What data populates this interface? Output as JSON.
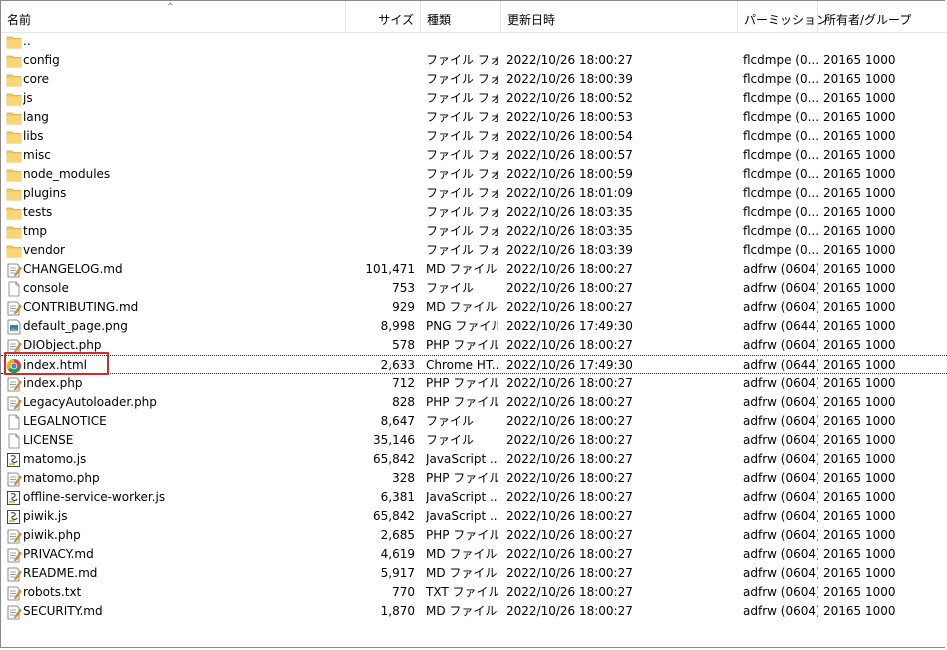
{
  "columns": {
    "name": "名前",
    "size": "サイズ",
    "type": "種類",
    "modified": "更新日時",
    "permission": "パーミッション",
    "owner": "所有者/グループ"
  },
  "rows": [
    {
      "name": "..",
      "size": "",
      "type": "",
      "date": "",
      "perm": "",
      "owner": "",
      "icon": "folder-icon"
    },
    {
      "name": "config",
      "size": "",
      "type": "ファイル フォ...",
      "date": "2022/10/26 18:00:27",
      "perm": "flcdmpe (0...",
      "owner": "20165 1000",
      "icon": "folder-icon"
    },
    {
      "name": "core",
      "size": "",
      "type": "ファイル フォ...",
      "date": "2022/10/26 18:00:39",
      "perm": "flcdmpe (0...",
      "owner": "20165 1000",
      "icon": "folder-icon"
    },
    {
      "name": "js",
      "size": "",
      "type": "ファイル フォ...",
      "date": "2022/10/26 18:00:52",
      "perm": "flcdmpe (0...",
      "owner": "20165 1000",
      "icon": "folder-icon"
    },
    {
      "name": "lang",
      "size": "",
      "type": "ファイル フォ...",
      "date": "2022/10/26 18:00:53",
      "perm": "flcdmpe (0...",
      "owner": "20165 1000",
      "icon": "folder-icon"
    },
    {
      "name": "libs",
      "size": "",
      "type": "ファイル フォ...",
      "date": "2022/10/26 18:00:54",
      "perm": "flcdmpe (0...",
      "owner": "20165 1000",
      "icon": "folder-icon"
    },
    {
      "name": "misc",
      "size": "",
      "type": "ファイル フォ...",
      "date": "2022/10/26 18:00:57",
      "perm": "flcdmpe (0...",
      "owner": "20165 1000",
      "icon": "folder-icon"
    },
    {
      "name": "node_modules",
      "size": "",
      "type": "ファイル フォ...",
      "date": "2022/10/26 18:00:59",
      "perm": "flcdmpe (0...",
      "owner": "20165 1000",
      "icon": "folder-icon"
    },
    {
      "name": "plugins",
      "size": "",
      "type": "ファイル フォ...",
      "date": "2022/10/26 18:01:09",
      "perm": "flcdmpe (0...",
      "owner": "20165 1000",
      "icon": "folder-icon"
    },
    {
      "name": "tests",
      "size": "",
      "type": "ファイル フォ...",
      "date": "2022/10/26 18:03:35",
      "perm": "flcdmpe (0...",
      "owner": "20165 1000",
      "icon": "folder-icon"
    },
    {
      "name": "tmp",
      "size": "",
      "type": "ファイル フォ...",
      "date": "2022/10/26 18:03:35",
      "perm": "flcdmpe (0...",
      "owner": "20165 1000",
      "icon": "folder-icon"
    },
    {
      "name": "vendor",
      "size": "",
      "type": "ファイル フォ...",
      "date": "2022/10/26 18:03:39",
      "perm": "flcdmpe (0...",
      "owner": "20165 1000",
      "icon": "folder-icon"
    },
    {
      "name": "CHANGELOG.md",
      "size": "101,471",
      "type": "MD ファイル",
      "date": "2022/10/26 18:00:27",
      "perm": "adfrw (0604)",
      "owner": "20165 1000",
      "icon": "markdown-file-icon"
    },
    {
      "name": "console",
      "size": "753",
      "type": "ファイル",
      "date": "2022/10/26 18:00:27",
      "perm": "adfrw (0604)",
      "owner": "20165 1000",
      "icon": "blank-file-icon"
    },
    {
      "name": "CONTRIBUTING.md",
      "size": "929",
      "type": "MD ファイル",
      "date": "2022/10/26 18:00:27",
      "perm": "adfrw (0604)",
      "owner": "20165 1000",
      "icon": "markdown-file-icon"
    },
    {
      "name": "default_page.png",
      "size": "8,998",
      "type": "PNG ファイル",
      "date": "2022/10/26 17:49:30",
      "perm": "adfrw (0644)",
      "owner": "20165 1000",
      "icon": "image-file-icon"
    },
    {
      "name": "DIObject.php",
      "size": "578",
      "type": "PHP ファイル",
      "date": "2022/10/26 18:00:27",
      "perm": "adfrw (0604)",
      "owner": "20165 1000",
      "icon": "php-file-icon"
    },
    {
      "name": "index.html",
      "size": "2,633",
      "type": "Chrome HT...",
      "date": "2022/10/26 17:49:30",
      "perm": "adfrw (0644)",
      "owner": "20165 1000",
      "icon": "chrome-icon",
      "focused": true
    },
    {
      "name": "index.php",
      "size": "712",
      "type": "PHP ファイル",
      "date": "2022/10/26 18:00:27",
      "perm": "adfrw (0604)",
      "owner": "20165 1000",
      "icon": "php-file-icon"
    },
    {
      "name": "LegacyAutoloader.php",
      "size": "828",
      "type": "PHP ファイル",
      "date": "2022/10/26 18:00:27",
      "perm": "adfrw (0604)",
      "owner": "20165 1000",
      "icon": "php-file-icon"
    },
    {
      "name": "LEGALNOTICE",
      "size": "8,647",
      "type": "ファイル",
      "date": "2022/10/26 18:00:27",
      "perm": "adfrw (0604)",
      "owner": "20165 1000",
      "icon": "blank-file-icon"
    },
    {
      "name": "LICENSE",
      "size": "35,146",
      "type": "ファイル",
      "date": "2022/10/26 18:00:27",
      "perm": "adfrw (0604)",
      "owner": "20165 1000",
      "icon": "blank-file-icon"
    },
    {
      "name": "matomo.js",
      "size": "65,842",
      "type": "JavaScript ...",
      "date": "2022/10/26 18:00:27",
      "perm": "adfrw (0604)",
      "owner": "20165 1000",
      "icon": "javascript-file-icon"
    },
    {
      "name": "matomo.php",
      "size": "328",
      "type": "PHP ファイル",
      "date": "2022/10/26 18:00:27",
      "perm": "adfrw (0604)",
      "owner": "20165 1000",
      "icon": "php-file-icon"
    },
    {
      "name": "offline-service-worker.js",
      "size": "6,381",
      "type": "JavaScript ...",
      "date": "2022/10/26 18:00:27",
      "perm": "adfrw (0604)",
      "owner": "20165 1000",
      "icon": "javascript-file-icon"
    },
    {
      "name": "piwik.js",
      "size": "65,842",
      "type": "JavaScript ...",
      "date": "2022/10/26 18:00:27",
      "perm": "adfrw (0604)",
      "owner": "20165 1000",
      "icon": "javascript-file-icon"
    },
    {
      "name": "piwik.php",
      "size": "2,685",
      "type": "PHP ファイル",
      "date": "2022/10/26 18:00:27",
      "perm": "adfrw (0604)",
      "owner": "20165 1000",
      "icon": "php-file-icon"
    },
    {
      "name": "PRIVACY.md",
      "size": "4,619",
      "type": "MD ファイル",
      "date": "2022/10/26 18:00:27",
      "perm": "adfrw (0604)",
      "owner": "20165 1000",
      "icon": "markdown-file-icon"
    },
    {
      "name": "README.md",
      "size": "5,917",
      "type": "MD ファイル",
      "date": "2022/10/26 18:00:27",
      "perm": "adfrw (0604)",
      "owner": "20165 1000",
      "icon": "markdown-file-icon"
    },
    {
      "name": "robots.txt",
      "size": "770",
      "type": "TXT ファイル",
      "date": "2022/10/26 18:00:27",
      "perm": "adfrw (0604)",
      "owner": "20165 1000",
      "icon": "text-file-icon"
    },
    {
      "name": "SECURITY.md",
      "size": "1,870",
      "type": "MD ファイル",
      "date": "2022/10/26 18:00:27",
      "perm": "adfrw (0604)",
      "owner": "20165 1000",
      "icon": "markdown-file-icon"
    }
  ],
  "colors": {
    "folder": "#f2c55c",
    "highlight": "#d32a2a",
    "grid": "#e5e5e5"
  }
}
